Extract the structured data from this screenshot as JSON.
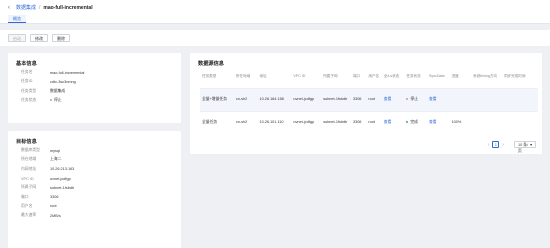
{
  "header": {
    "back_icon": "arrow-left-icon",
    "breadcrumb_parent": "数据集成",
    "separator": "/",
    "breadcrumb_current": "mao-full-incremental"
  },
  "tabs": [
    {
      "label": "概览"
    }
  ],
  "toolbar": {
    "start": "启动",
    "edit": "修改",
    "delete": "删除"
  },
  "basic_info": {
    "title": "基本信息",
    "rows": [
      {
        "key": "任务名",
        "value": "mao-full-incremental"
      },
      {
        "key": "任务ID",
        "value": "cdtc-3sc3nmng"
      },
      {
        "key": "任务类型",
        "value": "数据集成"
      },
      {
        "key": "任务状态",
        "value": "停止"
      }
    ]
  },
  "target_info": {
    "title": "目标信息",
    "rows": [
      {
        "key": "数据库类型",
        "value": "mysql"
      },
      {
        "key": "所在地域",
        "value": "上海二"
      },
      {
        "key": "内网地址",
        "value": "10.26.213.163"
      },
      {
        "key": "VPC ID",
        "value": "uvnet-jcdfgp"
      },
      {
        "key": "所属子网",
        "value": "subnet-1fsbdb"
      },
      {
        "key": "端口",
        "value": "3306"
      },
      {
        "key": "用户名",
        "value": "root"
      },
      {
        "key": "最大速率",
        "value": "2MB/s"
      }
    ]
  },
  "source_info": {
    "title": "数据源信息",
    "columns": [
      "任务类型",
      "所在地域",
      "地址",
      "VPC ID",
      "所属子网",
      "端口",
      "用户名",
      "全/Ls状态",
      "任务状态",
      "SyncData",
      "进度",
      "系统binlog方向",
      "同步完成时间"
    ],
    "rows": [
      {
        "type": "全量+增量任务",
        "region": "cn-sh2",
        "address": "10.26.164.158",
        "vpc": "uvnet-jcdfgp",
        "subnet": "subnet-1fsbdb",
        "port": "3306",
        "user": "root",
        "detail": "查看",
        "status": "停止",
        "sync": "查看",
        "progress": "",
        "binlog": "",
        "finish": ""
      },
      {
        "type": "全量任务",
        "region": "cn-sh2",
        "address": "10.26.101.110",
        "vpc": "uvnet-jcdfgp",
        "subnet": "subnet-1fsbdb",
        "port": "3306",
        "user": "root",
        "detail": "查看",
        "status": "完成",
        "sync": "查看",
        "progress": "100%",
        "binlog": "",
        "finish": ""
      }
    ],
    "pager": {
      "prev": "‹",
      "page": "1",
      "next": "›",
      "page_size": "10 条/页"
    }
  }
}
